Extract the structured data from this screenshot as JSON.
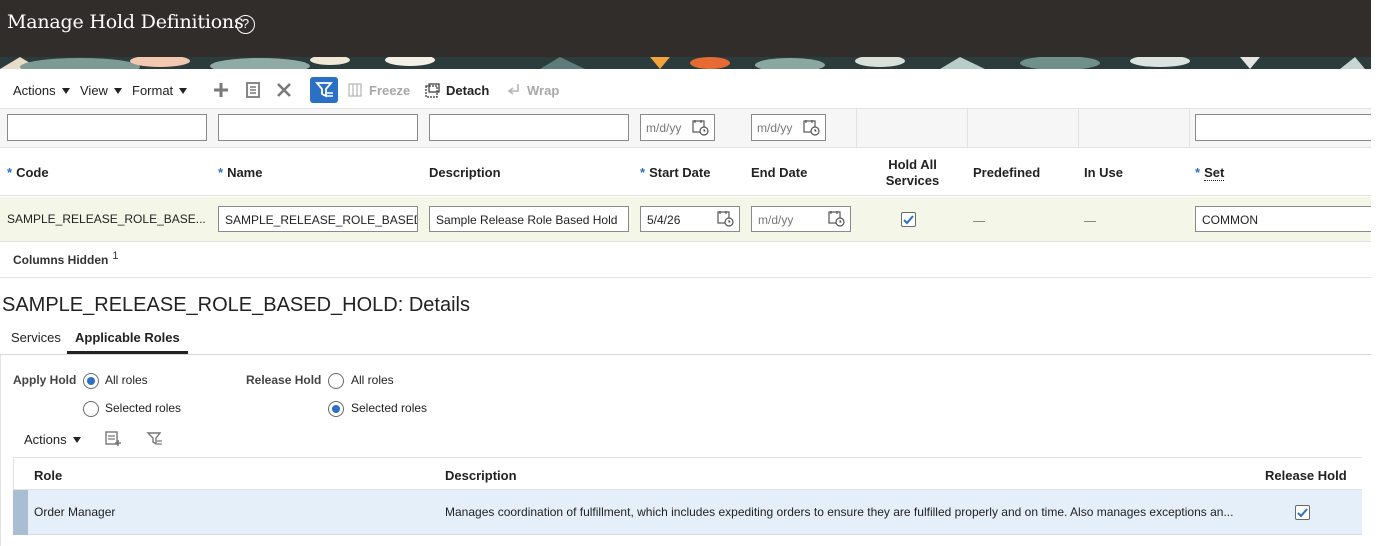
{
  "page": {
    "title": "Manage Hold Definitions",
    "help_icon": "question-circle-icon"
  },
  "toolbar": {
    "actions": "Actions",
    "view": "View",
    "format": "Format",
    "freeze": "Freeze",
    "detach": "Detach",
    "wrap": "Wrap"
  },
  "filters": {
    "start_date_placeholder": "m/d/yy",
    "end_date_placeholder": "m/d/yy"
  },
  "columns": {
    "code": "Code",
    "name": "Name",
    "description": "Description",
    "start_date": "Start Date",
    "end_date": "End Date",
    "hold_all_services_line1": "Hold All",
    "hold_all_services_line2": "Services",
    "predefined": "Predefined",
    "in_use": "In Use",
    "set": "Set",
    "required_marker": "*"
  },
  "row": {
    "code": "SAMPLE_RELEASE_ROLE_BASE...",
    "name": "SAMPLE_RELEASE_ROLE_BASED",
    "description": "Sample Release Role Based Hold",
    "start_date": "5/4/26",
    "end_date_placeholder": "m/d/yy",
    "hold_all_services": true,
    "set": "COMMON"
  },
  "columns_hidden": {
    "label": "Columns Hidden",
    "count": "1"
  },
  "details": {
    "title": "SAMPLE_RELEASE_ROLE_BASED_HOLD: Details",
    "tabs": [
      {
        "label": "Services",
        "active": false
      },
      {
        "label": "Applicable Roles",
        "active": true
      }
    ],
    "apply_hold": {
      "label": "Apply Hold",
      "options": [
        "All roles",
        "Selected roles"
      ],
      "selected": "All roles"
    },
    "release_hold": {
      "label": "Release Hold",
      "options": [
        "All roles",
        "Selected roles"
      ],
      "selected": "Selected roles"
    },
    "actions": "Actions",
    "role_table": {
      "headers": [
        "Role",
        "Description",
        "Release Hold"
      ],
      "rows": [
        {
          "role": "Order Manager",
          "description": "Manages coordination of fulfillment, which includes expediting orders to ensure they are fulfilled properly and on time. Also manages exceptions an...",
          "release_hold": true
        }
      ]
    }
  },
  "colors": {
    "header_bg": "#312d2a",
    "accent": "#2c70c5",
    "row_highlight": "#f4f6e8",
    "selected_row": "#e5effa"
  }
}
